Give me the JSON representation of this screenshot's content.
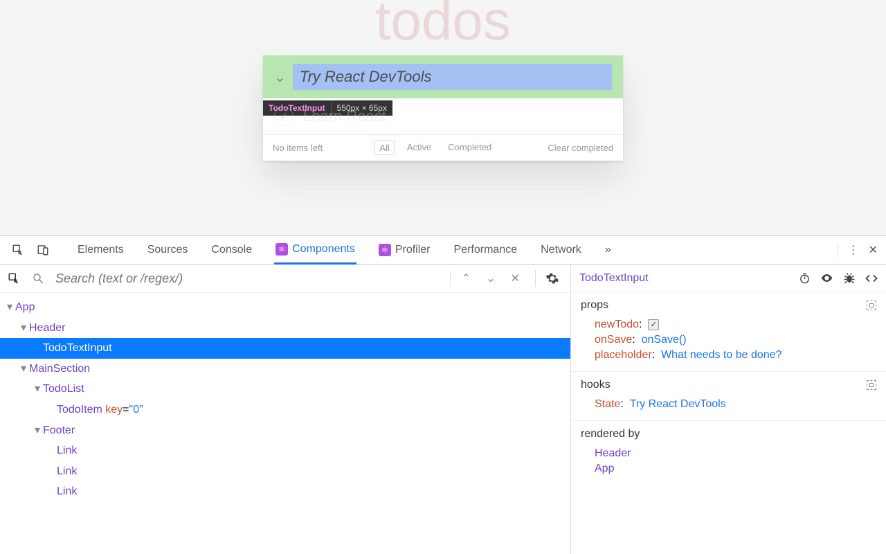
{
  "app": {
    "title": "todos",
    "input_value": "Try React DevTools",
    "tooltip_name": "TodoTextInput",
    "tooltip_dims": "550px × 65px",
    "item_completed": "Learn React",
    "footer_left": "No items left",
    "filter_all": "All",
    "filter_active": "Active",
    "filter_completed": "Completed",
    "clear": "Clear completed"
  },
  "tabs": {
    "elements": "Elements",
    "sources": "Sources",
    "console": "Console",
    "components": "Components",
    "profiler": "Profiler",
    "performance": "Performance",
    "network": "Network"
  },
  "search": {
    "placeholder": "Search (text or /regex/)"
  },
  "tree": {
    "app": "App",
    "header": "Header",
    "todotextinput": "TodoTextInput",
    "mainsection": "MainSection",
    "todolist": "TodoList",
    "todoitem": "TodoItem",
    "todoitem_key_label": "key",
    "todoitem_key_value": "\"0\"",
    "footer": "Footer",
    "link": "Link"
  },
  "detail": {
    "component_name": "TodoTextInput",
    "props_label": "props",
    "prop_newTodo_k": "newTodo",
    "prop_onSave_k": "onSave",
    "prop_onSave_v": "onSave()",
    "prop_placeholder_k": "placeholder",
    "prop_placeholder_v": "What needs to be done?",
    "hooks_label": "hooks",
    "hook_state_k": "State",
    "hook_state_v": "Try React DevTools",
    "renderedby_label": "rendered by",
    "rb_header": "Header",
    "rb_app": "App"
  }
}
